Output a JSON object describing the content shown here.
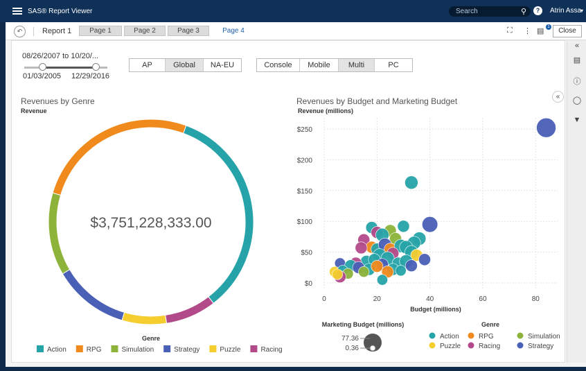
{
  "app": {
    "title": "SAS® Report Viewer",
    "search_placeholder": "Search",
    "user": "Atrin Assa"
  },
  "toolbar": {
    "report_name": "Report 1",
    "pages": [
      "Page 1",
      "Page 2",
      "Page 3",
      "Page 4"
    ],
    "active_page": "Page 4",
    "notification_count": "1",
    "close_label": "Close"
  },
  "filters": {
    "date_range_label": "08/26/2007 to 10/20/...",
    "slider_min": "01/03/2005",
    "slider_max": "12/29/2016",
    "regions": [
      "AP",
      "Global",
      "NA-EU"
    ],
    "region_selected": "Global",
    "platforms": [
      "Console",
      "Mobile",
      "Multi",
      "PC"
    ],
    "platform_selected": "Multi"
  },
  "colors": {
    "Action": "#26a3a8",
    "RPG": "#f08a1c",
    "Simulation": "#8db33a",
    "Strategy": "#4a5fb6",
    "Puzzle": "#f6cd2f",
    "Racing": "#b24a8a"
  },
  "chart_data": [
    {
      "type": "pie",
      "title": "Revenues by Genre",
      "subtitle": "Revenue",
      "center_value": "$3,751,228,333.00",
      "legend_title": "Genre",
      "categories": [
        "Action",
        "Racing",
        "Puzzle",
        "Strategy",
        "Simulation",
        "RPG"
      ],
      "values": [
        34,
        8,
        7,
        12,
        13,
        26
      ],
      "legend": [
        "Action",
        "RPG",
        "Simulation",
        "Strategy",
        "Puzzle",
        "Racing"
      ]
    },
    {
      "type": "scatter",
      "title": "Revenues by Budget and Marketing Budget",
      "ylabel": "Revenue (millions)",
      "xlabel": "Budget (millions)",
      "size_label": "Marketing Budget (millions)",
      "size_max": "77.36",
      "size_min": "0.36",
      "legend_title": "Genre",
      "legend": [
        "Action",
        "RPG",
        "Simulation",
        "Puzzle",
        "Racing",
        "Strategy"
      ],
      "xlim": [
        0,
        87
      ],
      "ylim": [
        -5,
        255
      ],
      "x_ticks": [
        0,
        20,
        40,
        60,
        80
      ],
      "y_ticks": [
        0,
        50,
        100,
        150,
        200,
        250
      ],
      "y_tick_labels": [
        "$0",
        "$50",
        "$100",
        "$150",
        "$200",
        "$250"
      ],
      "points": [
        {
          "x": 84,
          "y": 252,
          "genre": "Strategy",
          "s": 1.0
        },
        {
          "x": 33,
          "y": 163,
          "genre": "Action",
          "s": 0.5
        },
        {
          "x": 40,
          "y": 95,
          "genre": "Strategy",
          "s": 0.7
        },
        {
          "x": 30,
          "y": 92,
          "genre": "Action",
          "s": 0.4
        },
        {
          "x": 18,
          "y": 90,
          "genre": "Action",
          "s": 0.4
        },
        {
          "x": 20,
          "y": 82,
          "genre": "Racing",
          "s": 0.4
        },
        {
          "x": 25,
          "y": 85,
          "genre": "Simulation",
          "s": 0.4
        },
        {
          "x": 22,
          "y": 78,
          "genre": "Action",
          "s": 0.5
        },
        {
          "x": 36,
          "y": 72,
          "genre": "Action",
          "s": 0.5
        },
        {
          "x": 34,
          "y": 65,
          "genre": "Action",
          "s": 0.5
        },
        {
          "x": 27,
          "y": 72,
          "genre": "Simulation",
          "s": 0.4
        },
        {
          "x": 15,
          "y": 70,
          "genre": "Racing",
          "s": 0.4
        },
        {
          "x": 18,
          "y": 58,
          "genre": "RPG",
          "s": 0.4
        },
        {
          "x": 20,
          "y": 55,
          "genre": "Action",
          "s": 0.4
        },
        {
          "x": 23,
          "y": 62,
          "genre": "Strategy",
          "s": 0.5
        },
        {
          "x": 25,
          "y": 55,
          "genre": "RPG",
          "s": 0.4
        },
        {
          "x": 29,
          "y": 60,
          "genre": "Action",
          "s": 0.5
        },
        {
          "x": 31,
          "y": 58,
          "genre": "Action",
          "s": 0.5
        },
        {
          "x": 14,
          "y": 57,
          "genre": "Racing",
          "s": 0.4
        },
        {
          "x": 21,
          "y": 45,
          "genre": "Action",
          "s": 0.5
        },
        {
          "x": 26,
          "y": 48,
          "genre": "Racing",
          "s": 0.4
        },
        {
          "x": 33,
          "y": 50,
          "genre": "Action",
          "s": 0.5
        },
        {
          "x": 35,
          "y": 45,
          "genre": "Puzzle",
          "s": 0.4
        },
        {
          "x": 38,
          "y": 38,
          "genre": "Strategy",
          "s": 0.4
        },
        {
          "x": 16,
          "y": 35,
          "genre": "Action",
          "s": 0.4
        },
        {
          "x": 19,
          "y": 38,
          "genre": "Action",
          "s": 0.4
        },
        {
          "x": 24,
          "y": 40,
          "genre": "Action",
          "s": 0.5
        },
        {
          "x": 12,
          "y": 32,
          "genre": "Racing",
          "s": 0.4
        },
        {
          "x": 22,
          "y": 30,
          "genre": "Strategy",
          "s": 0.4
        },
        {
          "x": 28,
          "y": 32,
          "genre": "Action",
          "s": 0.4
        },
        {
          "x": 31,
          "y": 35,
          "genre": "Action",
          "s": 0.5
        },
        {
          "x": 6,
          "y": 32,
          "genre": "Strategy",
          "s": 0.3
        },
        {
          "x": 10,
          "y": 28,
          "genre": "Action",
          "s": 0.4
        },
        {
          "x": 13,
          "y": 25,
          "genre": "Strategy",
          "s": 0.4
        },
        {
          "x": 17,
          "y": 22,
          "genre": "Action",
          "s": 0.4
        },
        {
          "x": 20,
          "y": 27,
          "genre": "RPG",
          "s": 0.4
        },
        {
          "x": 26,
          "y": 22,
          "genre": "Action",
          "s": 0.4
        },
        {
          "x": 33,
          "y": 28,
          "genre": "Strategy",
          "s": 0.4
        },
        {
          "x": 4,
          "y": 18,
          "genre": "Puzzle",
          "s": 0.3
        },
        {
          "x": 7,
          "y": 20,
          "genre": "Action",
          "s": 0.3
        },
        {
          "x": 9,
          "y": 15,
          "genre": "Simulation",
          "s": 0.3
        },
        {
          "x": 15,
          "y": 18,
          "genre": "Simulation",
          "s": 0.3
        },
        {
          "x": 24,
          "y": 18,
          "genre": "RPG",
          "s": 0.4
        },
        {
          "x": 29,
          "y": 20,
          "genre": "Action",
          "s": 0.3
        },
        {
          "x": 6,
          "y": 10,
          "genre": "Racing",
          "s": 0.4
        },
        {
          "x": 5,
          "y": 14,
          "genre": "Puzzle",
          "s": 0.3
        },
        {
          "x": 22,
          "y": 5,
          "genre": "Action",
          "s": 0.3
        }
      ]
    }
  ]
}
